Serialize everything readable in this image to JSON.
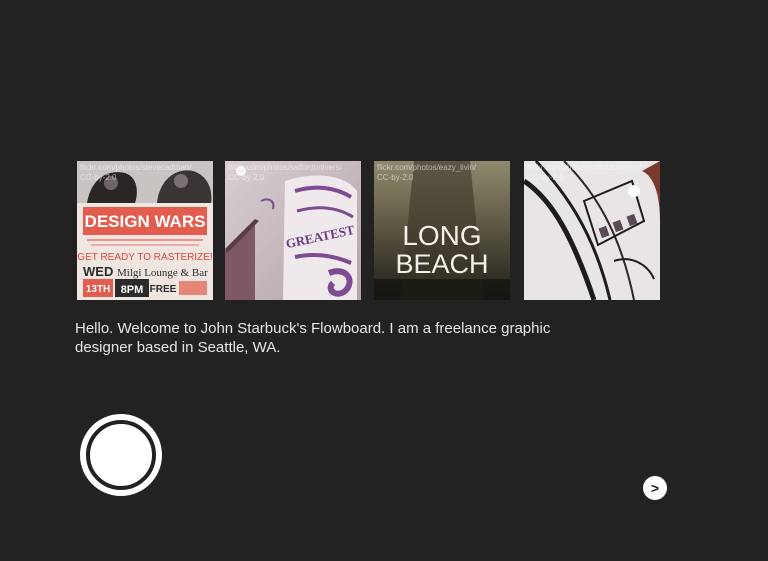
{
  "thumbnails": [
    {
      "credit_line1": "flickr.com/photos/stevecadman/",
      "credit_line2": "CC-by-2.0",
      "poster_title": "DESIGN WARS",
      "poster_sub": "GET READY TO RASTERIZE!",
      "poster_day": "WED",
      "poster_date": "13TH",
      "poster_time": "8PM",
      "poster_free": "FREE",
      "poster_venue": "Milgi Lounge & Bar"
    },
    {
      "credit_line1": "flickr.com/photos/salfordunivers/",
      "credit_line2": "CC-by-2.0",
      "mural_text": "GREATEST"
    },
    {
      "credit_line1": "flickr.com/photos/eazy_livin/",
      "credit_line2": "CC-by-2.0",
      "sign_line1": "LONG",
      "sign_line2": "BEACH"
    },
    {
      "credit_line1": "flickr.com/photos/salfordunivers/",
      "credit_line2": "CC-by-2.0"
    }
  ],
  "intro_text": "Hello. Welcome to John Starbuck's Flowboard. I am a freelance graphic designer based in Seattle, WA.",
  "next_label": ">",
  "colors": {
    "background": "#232223",
    "text": "#e6e6e6",
    "poster_red": "#e0453a"
  }
}
